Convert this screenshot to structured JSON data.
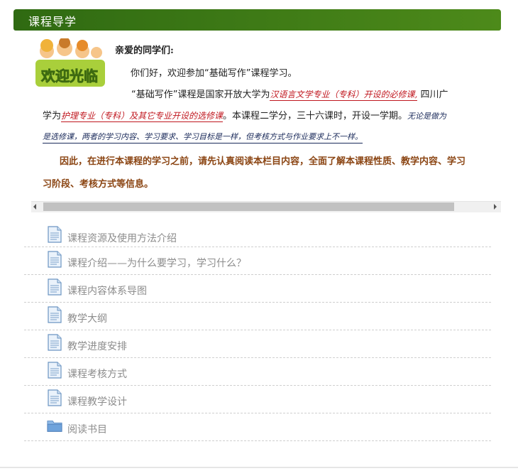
{
  "header": {
    "title": "课程导学"
  },
  "intro": {
    "welcome_image_text": "欢迎光临",
    "salute": "亲爱的同学们:",
    "line1": "你们好，欢迎参加“基础写作”课程学习。",
    "line2_prefix": "“基础写作”课程是国家开放大学为",
    "line2_hand": "汉语言文学专业（专科）开设的必修课,",
    "line2_suffix": "四川广",
    "line3_prefix": "学为",
    "line3_hand": "护理专业（专科）及其它专业开设的选修课",
    "line3_suffix": "。本课程二学分，三十六课时，开设一学期。",
    "line3_tail": "无论是做为",
    "line4_hand": "是选修课，两者的学习内容、学习要求、学习目标是一样，但考核方式与作业要求上不一样。",
    "line5": "因此，在进行本课程的学习之前，请先认真阅读本栏目内容，全面了解本课程性质、教学内容、学习",
    "line6": "习阶段、考核方式等信息。"
  },
  "links": [
    {
      "label": "课程资源及使用方法介绍",
      "icon": "document-icon"
    },
    {
      "label": "课程介绍——为什么要学习，学习什么？",
      "icon": "document-icon"
    },
    {
      "label": "课程内容体系导图",
      "icon": "document-icon"
    },
    {
      "label": "教学大纲",
      "icon": "document-icon"
    },
    {
      "label": "教学进度安排",
      "icon": "document-icon"
    },
    {
      "label": "课程考核方式",
      "icon": "document-icon"
    },
    {
      "label": "课程教学设计",
      "icon": "document-icon"
    },
    {
      "label": "阅读书目",
      "icon": "folder-icon"
    }
  ],
  "colors": {
    "header_green": "#3d7a16",
    "link_gray": "#8c8c8c",
    "hand_red": "#c0171f",
    "brown_bold": "#8b4513"
  }
}
